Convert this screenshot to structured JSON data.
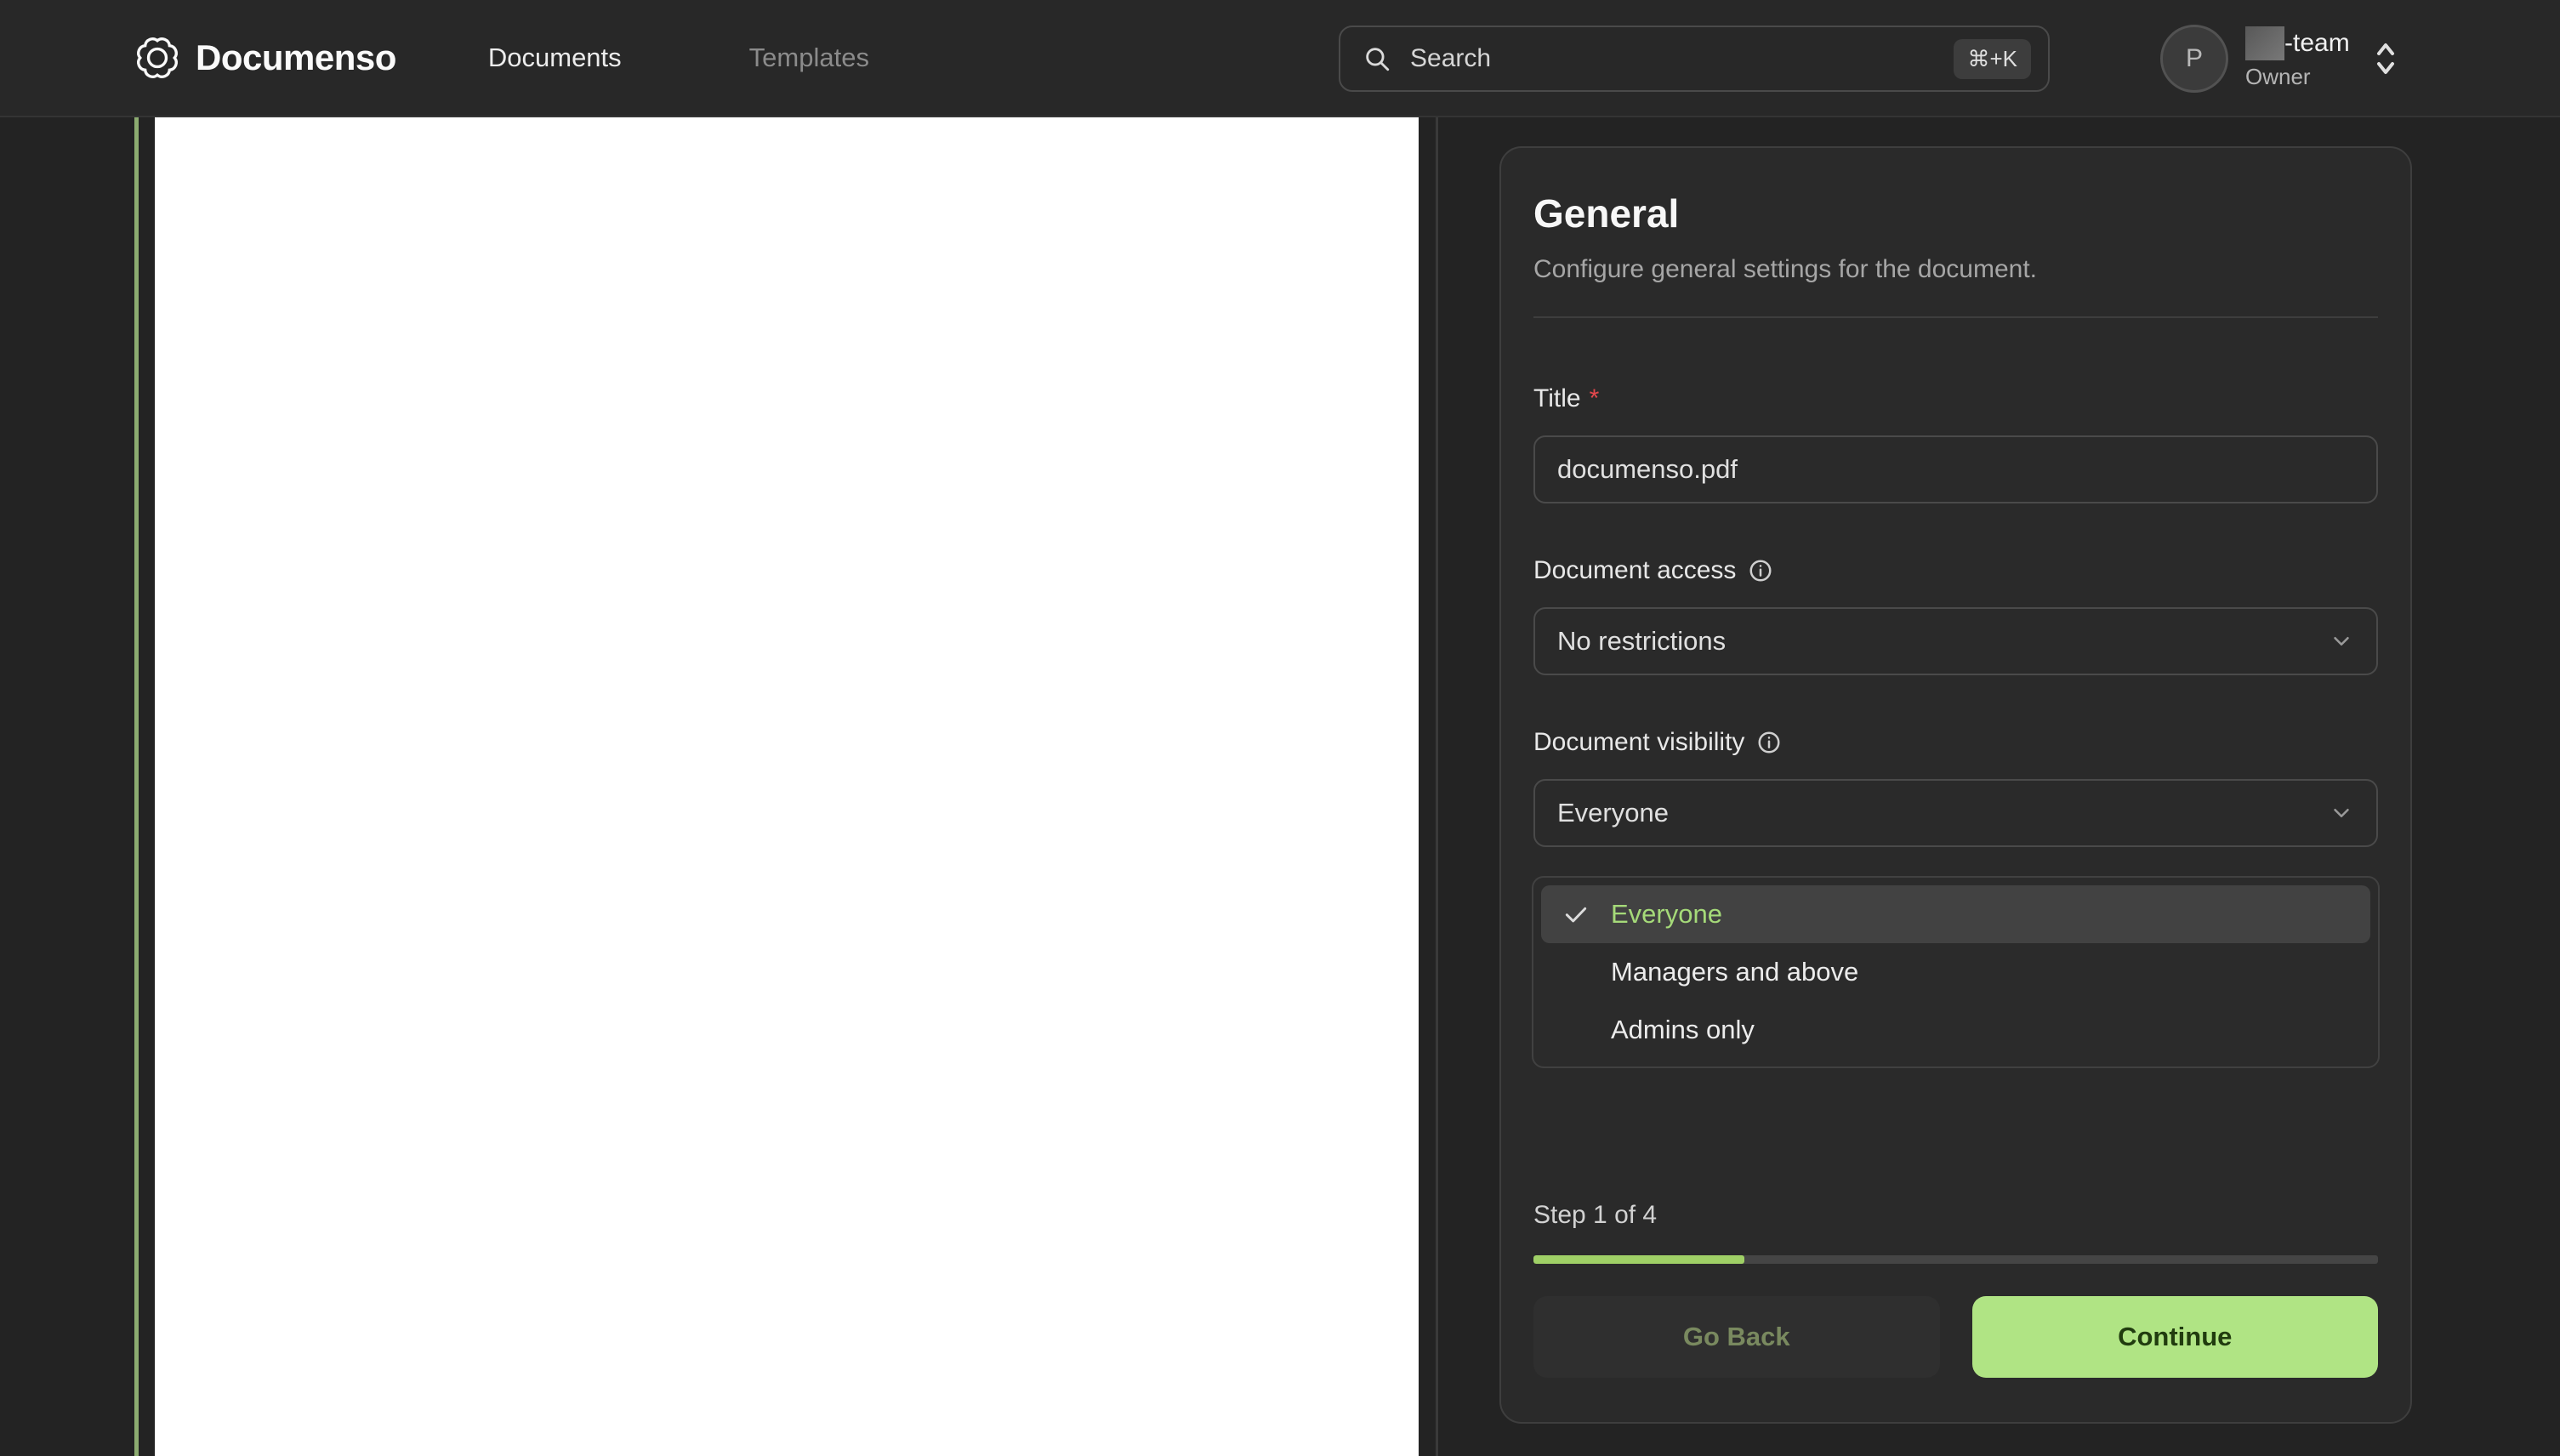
{
  "nav": {
    "brand": "Documenso",
    "links": [
      {
        "label": "Documents"
      },
      {
        "label": "Templates"
      }
    ],
    "search": {
      "placeholder": "Search",
      "shortcut": "⌘+K"
    },
    "profile": {
      "avatar_initial": "P",
      "team_suffix": "-team",
      "role": "Owner"
    }
  },
  "panel": {
    "title": "General",
    "subtitle": "Configure general settings for the document.",
    "fields": {
      "title": {
        "label": "Title",
        "required_marker": "*",
        "value": "documenso.pdf"
      },
      "access": {
        "label": "Document access",
        "value": "No restrictions"
      },
      "visibility": {
        "label": "Document visibility",
        "value": "Everyone"
      }
    },
    "visibility_menu": {
      "options": [
        {
          "label": "Everyone",
          "selected": true,
          "check": "✓"
        },
        {
          "label": "Managers and above",
          "selected": false
        },
        {
          "label": "Admins only",
          "selected": false
        }
      ]
    },
    "footer": {
      "step_text": "Step 1 of 4",
      "progress_percent": 25,
      "back_label": "Go Back",
      "continue_label": "Continue"
    }
  },
  "colors": {
    "accent_green": "#a2e771",
    "accent_line": "#8cab70",
    "selected_option_text": "#a5da79",
    "required_red": "#e5484d",
    "nav_bg": "#282828",
    "card_bg": "#2a2a2a"
  }
}
